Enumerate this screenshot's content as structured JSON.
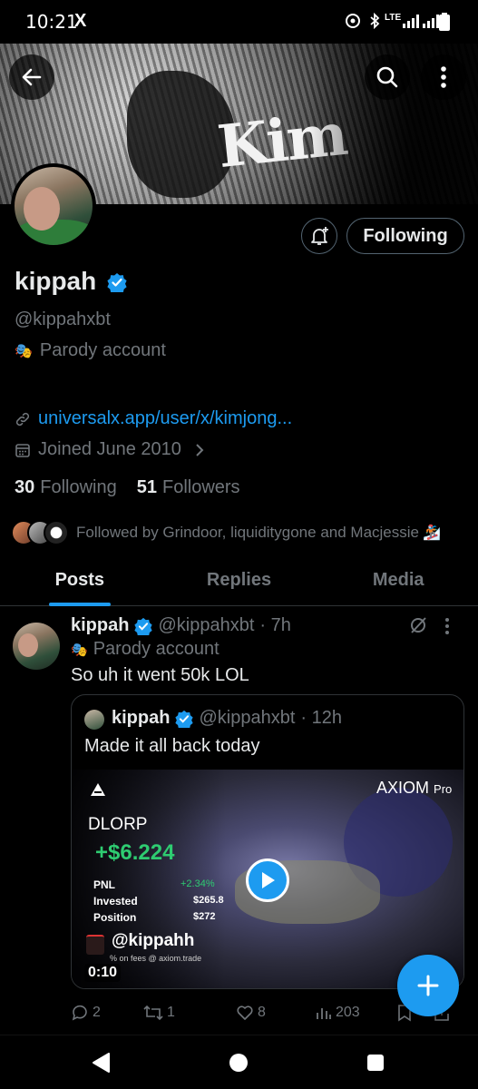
{
  "status_bar": {
    "time": "10:21",
    "x_icon": "X",
    "net_label": "LTE"
  },
  "banner": {
    "text": "Kim"
  },
  "profile": {
    "display_name": "kippah",
    "handle": "@kippahxbt",
    "parody_label": "Parody account",
    "link": "universalx.app/user/x/kimjong...",
    "joined": "Joined June 2010",
    "following_count": "30",
    "following_label": "Following",
    "followers_count": "51",
    "followers_label": "Followers",
    "followed_by": "Followed by Grindoor, liquiditygone and Macjessie",
    "following_button": "Following"
  },
  "tabs": [
    {
      "label": "Posts",
      "active": true
    },
    {
      "label": "Replies",
      "active": false
    },
    {
      "label": "Media",
      "active": false
    }
  ],
  "tweet": {
    "name": "kippah",
    "handle": "@kippahxbt",
    "time": "· 7h",
    "parody_label": "Parody account",
    "text": "So uh it went 50k LOL",
    "quote": {
      "name": "kippah",
      "handle": "@kippahxbt",
      "time": "· 12h",
      "text": "Made it all back today",
      "media": {
        "brand": "AXIOM",
        "brand_suffix": "Pro",
        "token": "DLORP",
        "pnl_amount": "+$6.224",
        "rows": [
          {
            "label": "PNL",
            "value": "+2.34%"
          },
          {
            "label": "Invested",
            "value": "$265.8"
          },
          {
            "label": "Position",
            "value": "$272"
          }
        ],
        "user": "@kippahh",
        "footer": "% on fees  @ axiom.trade",
        "duration": "0:10"
      }
    },
    "actions": {
      "replies": "2",
      "reposts": "1",
      "likes": "8",
      "views": "203"
    }
  },
  "colors": {
    "accent": "#1d9bf0",
    "text": "#e7e9ea",
    "muted": "#71767b",
    "border": "#2f3336",
    "gain": "#2ecc71"
  }
}
